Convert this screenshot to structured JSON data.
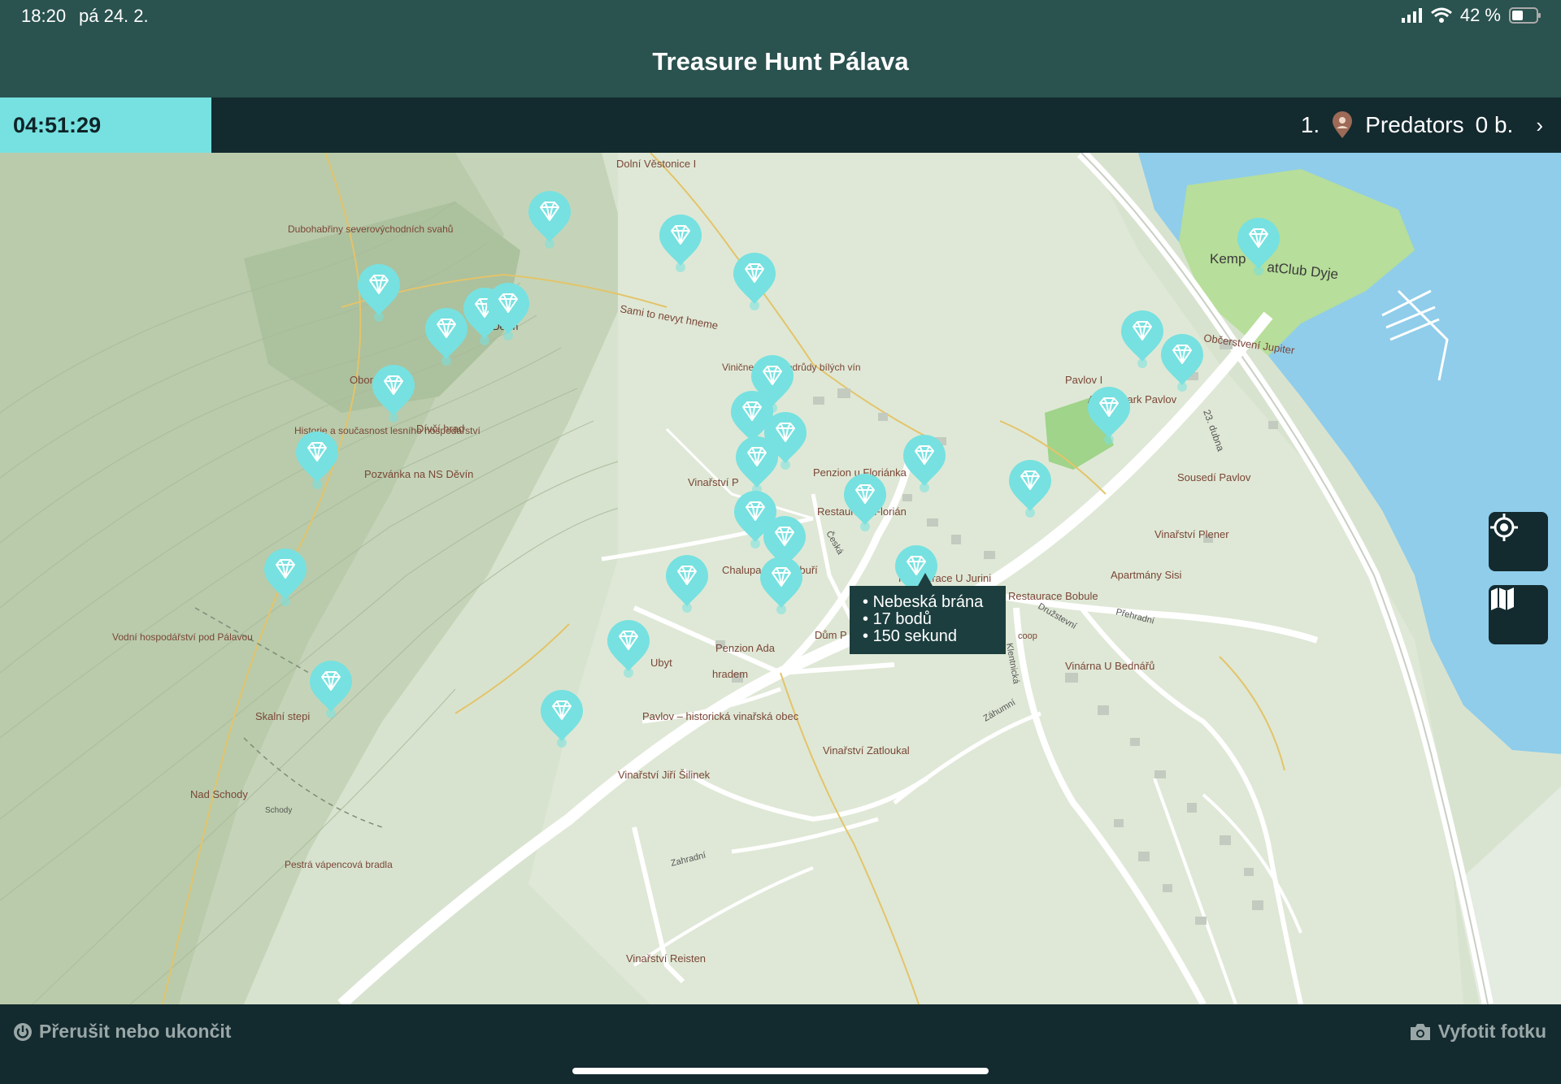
{
  "status_bar": {
    "time": "18:20",
    "date": "pá 24. 2.",
    "battery": "42 %"
  },
  "header": {
    "title": "Treasure Hunt Pálava"
  },
  "info_bar": {
    "timer": "04:51:29",
    "rank": "1.",
    "team_name": "Predators",
    "score": "0 b.",
    "chevron": "›"
  },
  "map": {
    "place_labels": [
      "Dolní Věstonice I",
      "Dubohabřiny severovýchodních svahů",
      "Sami to nevyt hneme",
      "Vinične tratě – odrůdy bílých vín",
      "Obora rozc.",
      "Dívčí hrad",
      "Historie a současnost lesního hospodářství",
      "Pozvánka na NS Děvín",
      "Vodní hospodářství pod Pálavou",
      "Skalní stepi",
      "Nad Schody",
      "Schody",
      "Pestrá vápencová bradla",
      "Penzion u Floriánka",
      "Restaurace Florián",
      "Vinařství P",
      "Chalupa Na Cimbuří",
      "Penzion Ada",
      "Ubyt",
      "hradem",
      "Dům P",
      "Pavlov – historická vinařská obec",
      "Vinařství Jiří Šilinek",
      "Zahradní",
      "Vinařství Reisten",
      "Vinařství Zatloukal",
      "Restaurace U Jurini",
      "Restaurace Bobule",
      "Družstevní",
      "Apartmány Sisi",
      "Vinařství Plener",
      "Sousedí Pavlov",
      "Přehradní",
      "Vinárna U Bednářů",
      "Kemp",
      "atClub Dyje",
      "Občerstvení Jupiter",
      "Pavlov I",
      "Archeopark Pavlov",
      "23. dubna",
      "Česká",
      "Klentnická",
      "Záhumní",
      "coop",
      "Děvín"
    ]
  },
  "tooltip": {
    "name": "Nebeská brána",
    "points": "17 bodů",
    "time": "150 sekund"
  },
  "side_buttons": {
    "locate": "locate-icon",
    "map": "map-icon"
  },
  "bottom_bar": {
    "quit_label": "Přerušit nebo ukončit",
    "photo_label": "Vyfotit fotku"
  },
  "colors": {
    "accent": "#76e1e0",
    "dark": "#132a2f",
    "header": "#2a524f",
    "water": "#8fcdea",
    "map_land": "#d8e3cf"
  }
}
